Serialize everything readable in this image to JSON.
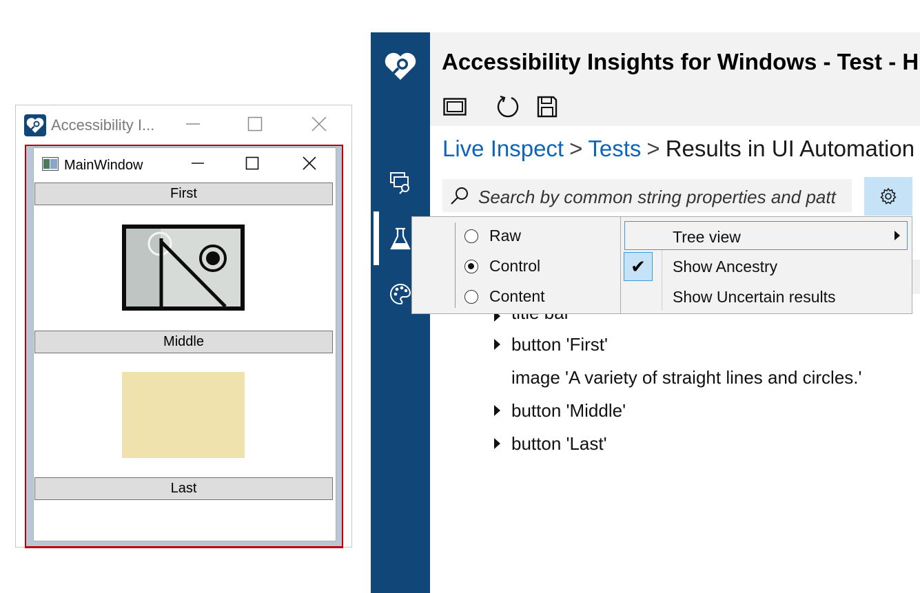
{
  "small_window": {
    "title": "Accessibility I...",
    "main_window": {
      "title": "MainWindow",
      "buttons": [
        "First",
        "Middle",
        "Last"
      ]
    }
  },
  "ai_window": {
    "title": "Accessibility Insights for Windows - Test - H",
    "breadcrumb": {
      "live_inspect": "Live Inspect",
      "tests": "Tests",
      "current": "Results in UI Automation",
      "separator": ">"
    },
    "search": {
      "placeholder": "Search by common string properties and patt"
    },
    "tree": {
      "partial_row": "title bar",
      "rows": [
        {
          "label": "button 'First'",
          "expandable": true
        },
        {
          "label": "image 'A variety of straight lines and circles.'",
          "expandable": false
        },
        {
          "label": "button 'Middle'",
          "expandable": true
        },
        {
          "label": "button 'Last'",
          "expandable": true
        }
      ]
    }
  },
  "menu": {
    "view_options": [
      {
        "label": "Raw",
        "selected": false
      },
      {
        "label": "Control",
        "selected": true
      },
      {
        "label": "Content",
        "selected": false
      }
    ],
    "items": {
      "tree_view": "Tree view",
      "show_ancestry": "Show Ancestry",
      "show_uncertain": "Show Uncertain results"
    },
    "check_mark": "✔"
  },
  "colors": {
    "sidebar": "#114679",
    "link": "#0d64b8",
    "accent_light": "#c6e2f6",
    "accent_border": "#3b9ad9",
    "red_frame": "#c00000",
    "rect_image": "#f0e2ad"
  },
  "icons": {
    "app": "heart-magnifier-icon",
    "live_inspect": "live-inspect-icon",
    "tests": "flask-icon",
    "color_contrast": "palette-icon",
    "window_select": "window-select-icon",
    "refresh": "refresh-icon",
    "save": "save-icon",
    "search": "search-icon",
    "settings": "gear-icon"
  }
}
